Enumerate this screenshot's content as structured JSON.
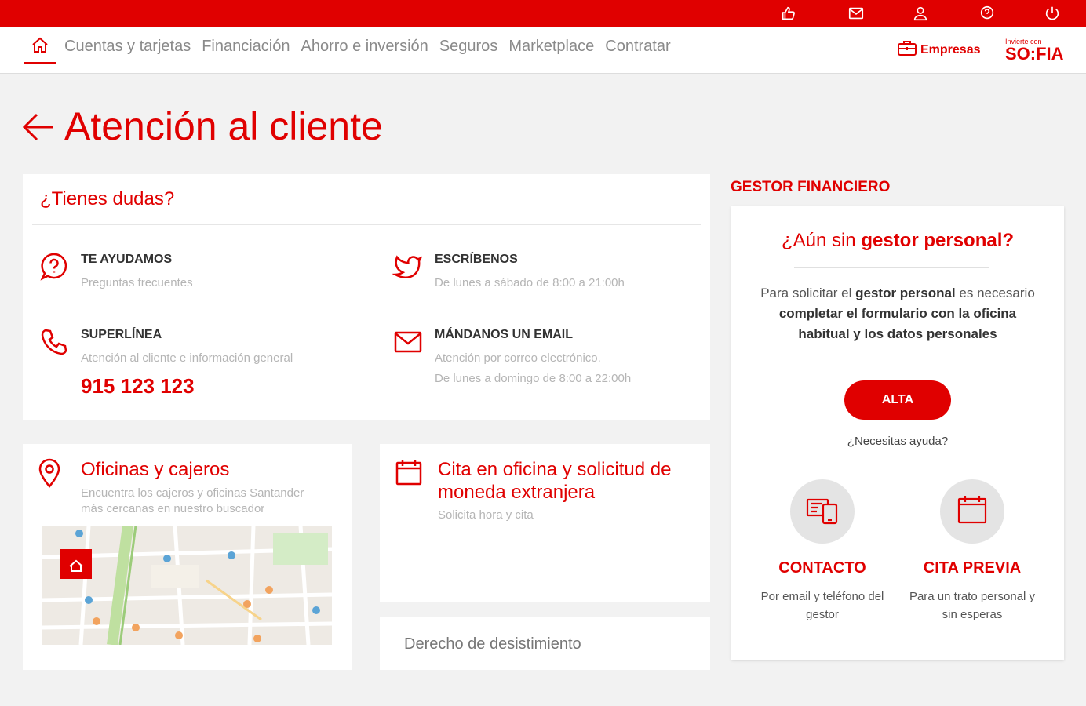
{
  "colors": {
    "brand": "#e00000",
    "background": "#f2f2f2"
  },
  "topbar": {
    "icons": [
      "thumbs-up-icon",
      "mail-icon",
      "user-icon",
      "help-icon",
      "power-icon"
    ]
  },
  "nav": {
    "items": [
      "Cuentas y tarjetas",
      "Financiación",
      "Ahorro e inversión",
      "Seguros",
      "Marketplace",
      "Contratar"
    ],
    "empresas": "Empresas",
    "sofia_small": "Invierte con",
    "sofia_big": "SO:FIA"
  },
  "page": {
    "title": "Atención al cliente"
  },
  "dudas": {
    "heading": "¿Tienes dudas?",
    "items": [
      {
        "label": "TE AYUDAMOS",
        "sub": "Preguntas frecuentes"
      },
      {
        "label": "ESCRÍBENOS",
        "sub": "De lunes a sábado de 8:00 a 21:00h"
      },
      {
        "label": "SUPERLÍNEA",
        "sub": "Atención al cliente e información general",
        "phone": "915 123 123"
      },
      {
        "label": "MÁNDANOS UN EMAIL",
        "sub": "Atención por correo electrónico.",
        "sub2": "De lunes a domingo de 8:00 a 22:00h"
      }
    ]
  },
  "oficinas": {
    "title": "Oficinas y cajeros",
    "sub1": "Encuentra los cajeros y oficinas Santander",
    "sub2": "más cercanas en nuestro buscador"
  },
  "cita": {
    "title1": "Cita en oficina y solicitud de",
    "title2": "moneda extranjera",
    "sub": "Solicita hora y cita"
  },
  "derecho": {
    "label": "Derecho de desistimiento"
  },
  "gestor": {
    "heading": "GESTOR FINANCIERO",
    "q_pre": "¿Aún sin ",
    "q_bold": "gestor personal?",
    "d1": "Para solicitar el ",
    "d2": "gestor personal",
    "d3": " es necesario ",
    "d4": "completar el formulario con la oficina habitual y los datos personales",
    "alta": "ALTA",
    "ayuda": "¿Necesitas ayuda?",
    "contacto_t": "CONTACTO",
    "contacto_s1": "Por email y teléfono del",
    "contacto_s2": "gestor",
    "cita_t": "CITA PREVIA",
    "cita_s1": "Para un trato personal y",
    "cita_s2": "sin esperas"
  }
}
